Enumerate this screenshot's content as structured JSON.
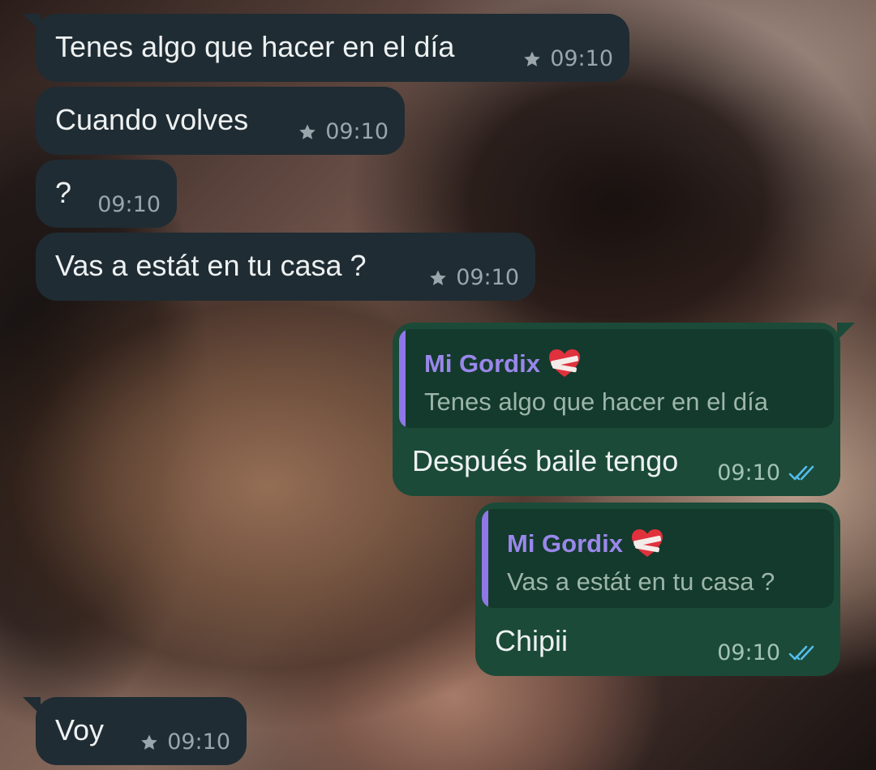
{
  "chat": {
    "messages": [
      {
        "text": "Tenes algo que hacer en el día",
        "time": "09:10",
        "starred": true
      },
      {
        "text": "Cuando volves",
        "time": "09:10",
        "starred": true
      },
      {
        "text": "?",
        "time": "09:10",
        "starred": false
      },
      {
        "text": "Vas a estát en tu casa ?",
        "time": "09:10",
        "starred": true
      },
      {
        "text": "Después baile tengo",
        "time": "09:10",
        "read": true,
        "reply": {
          "author": "Mi Gordix",
          "text": "Tenes algo que hacer en el día"
        }
      },
      {
        "text": "Chipii",
        "time": "09:10",
        "read": true,
        "reply": {
          "author": "Mi Gordix",
          "text": "Vas a estát en tu casa ?"
        }
      },
      {
        "text": "Voy",
        "time": "09:10",
        "starred": true
      }
    ]
  },
  "icons": {
    "star": "star-icon",
    "read_receipt": "double-check-icon",
    "heart": "bandaged-heart-icon"
  },
  "colors": {
    "incoming_bubble": "#1f2c33",
    "outgoing_bubble": "#1b4a38",
    "quote_accent": "#8f77e6",
    "read_ticks": "#53bdeb"
  }
}
